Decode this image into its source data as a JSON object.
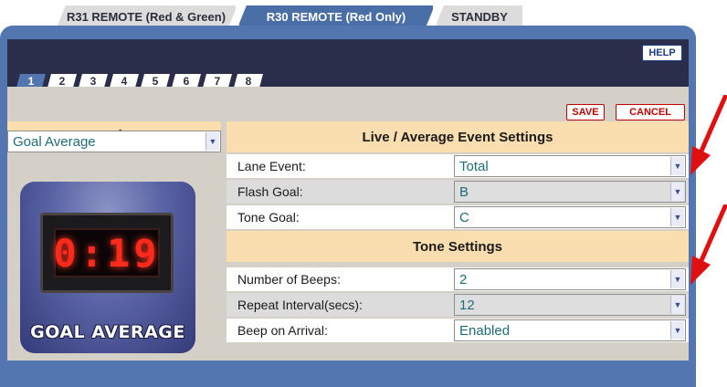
{
  "top_tabs": [
    {
      "label": "R31 REMOTE (Red & Green)",
      "active": false
    },
    {
      "label": "R30 REMOTE (Red Only)",
      "active": true
    },
    {
      "label": "STANDBY",
      "active": false
    }
  ],
  "help_label": "HELP",
  "number_tabs": [
    {
      "label": "1",
      "active": true
    },
    {
      "label": "2",
      "active": false
    },
    {
      "label": "3",
      "active": false
    },
    {
      "label": "4",
      "active": false
    },
    {
      "label": "5",
      "active": false
    },
    {
      "label": "6",
      "active": false
    },
    {
      "label": "7",
      "active": false
    },
    {
      "label": "8",
      "active": false
    }
  ],
  "toolbar": {
    "save_label": "SAVE",
    "cancel_label": "CANCEL"
  },
  "mode": {
    "header": "Mode:",
    "selected": "Goal Average",
    "clock_display": "0:19",
    "caption": "GOAL AVERAGE"
  },
  "live_average": {
    "header": "Live / Average Event Settings",
    "rows": [
      {
        "label": "Lane Event:",
        "value": "Total"
      },
      {
        "label": "Flash Goal:",
        "value": "B"
      },
      {
        "label": "Tone Goal:",
        "value": "C"
      }
    ]
  },
  "tone": {
    "header": "Tone Settings",
    "rows": [
      {
        "label": "Number of Beeps:",
        "value": "2"
      },
      {
        "label": "Repeat Interval(secs):",
        "value": "12"
      },
      {
        "label": "Beep on Arrival:",
        "value": "Enabled"
      }
    ]
  },
  "colors": {
    "frame": "#5476b0",
    "dark_bar": "#2a2e4a",
    "section_header": "#fbdeb0",
    "select_text": "#1d6d7a",
    "danger": "#c40000",
    "annotation_arrow": "#e01010"
  },
  "icons": {
    "dropdown": "chevron-down-icon",
    "annotation": "red-arrow-icon"
  }
}
